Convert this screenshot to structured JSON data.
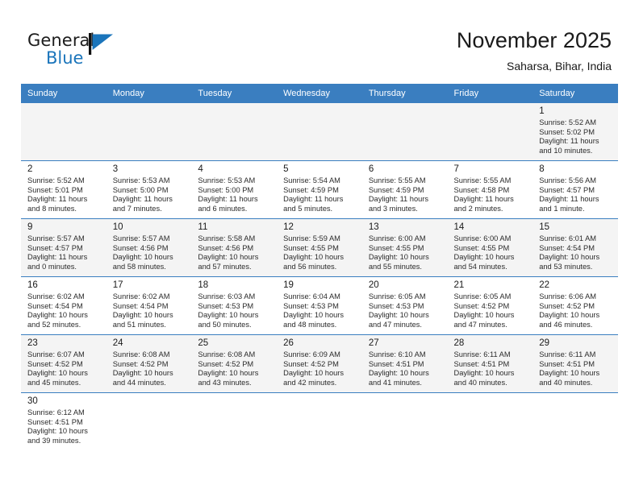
{
  "brand": {
    "name_part1": "General",
    "name_part2": "Blue",
    "flag_icon": "blue-triangle-flag-icon",
    "accent_color": "#1b75bb"
  },
  "header": {
    "title": "November 2025",
    "subtitle": "Saharsa, Bihar, India"
  },
  "calendar": {
    "header_bg": "#3a7ec0",
    "alt_row_bg": "#f4f4f4",
    "weekday_headers": [
      "Sunday",
      "Monday",
      "Tuesday",
      "Wednesday",
      "Thursday",
      "Friday",
      "Saturday"
    ],
    "weeks": [
      [
        {
          "day": "",
          "sunrise": "",
          "sunset": "",
          "daylight_line1": "",
          "daylight_line2": ""
        },
        {
          "day": "",
          "sunrise": "",
          "sunset": "",
          "daylight_line1": "",
          "daylight_line2": ""
        },
        {
          "day": "",
          "sunrise": "",
          "sunset": "",
          "daylight_line1": "",
          "daylight_line2": ""
        },
        {
          "day": "",
          "sunrise": "",
          "sunset": "",
          "daylight_line1": "",
          "daylight_line2": ""
        },
        {
          "day": "",
          "sunrise": "",
          "sunset": "",
          "daylight_line1": "",
          "daylight_line2": ""
        },
        {
          "day": "",
          "sunrise": "",
          "sunset": "",
          "daylight_line1": "",
          "daylight_line2": ""
        },
        {
          "day": "1",
          "sunrise": "Sunrise: 5:52 AM",
          "sunset": "Sunset: 5:02 PM",
          "daylight_line1": "Daylight: 11 hours",
          "daylight_line2": "and 10 minutes."
        }
      ],
      [
        {
          "day": "2",
          "sunrise": "Sunrise: 5:52 AM",
          "sunset": "Sunset: 5:01 PM",
          "daylight_line1": "Daylight: 11 hours",
          "daylight_line2": "and 8 minutes."
        },
        {
          "day": "3",
          "sunrise": "Sunrise: 5:53 AM",
          "sunset": "Sunset: 5:00 PM",
          "daylight_line1": "Daylight: 11 hours",
          "daylight_line2": "and 7 minutes."
        },
        {
          "day": "4",
          "sunrise": "Sunrise: 5:53 AM",
          "sunset": "Sunset: 5:00 PM",
          "daylight_line1": "Daylight: 11 hours",
          "daylight_line2": "and 6 minutes."
        },
        {
          "day": "5",
          "sunrise": "Sunrise: 5:54 AM",
          "sunset": "Sunset: 4:59 PM",
          "daylight_line1": "Daylight: 11 hours",
          "daylight_line2": "and 5 minutes."
        },
        {
          "day": "6",
          "sunrise": "Sunrise: 5:55 AM",
          "sunset": "Sunset: 4:59 PM",
          "daylight_line1": "Daylight: 11 hours",
          "daylight_line2": "and 3 minutes."
        },
        {
          "day": "7",
          "sunrise": "Sunrise: 5:55 AM",
          "sunset": "Sunset: 4:58 PM",
          "daylight_line1": "Daylight: 11 hours",
          "daylight_line2": "and 2 minutes."
        },
        {
          "day": "8",
          "sunrise": "Sunrise: 5:56 AM",
          "sunset": "Sunset: 4:57 PM",
          "daylight_line1": "Daylight: 11 hours",
          "daylight_line2": "and 1 minute."
        }
      ],
      [
        {
          "day": "9",
          "sunrise": "Sunrise: 5:57 AM",
          "sunset": "Sunset: 4:57 PM",
          "daylight_line1": "Daylight: 11 hours",
          "daylight_line2": "and 0 minutes."
        },
        {
          "day": "10",
          "sunrise": "Sunrise: 5:57 AM",
          "sunset": "Sunset: 4:56 PM",
          "daylight_line1": "Daylight: 10 hours",
          "daylight_line2": "and 58 minutes."
        },
        {
          "day": "11",
          "sunrise": "Sunrise: 5:58 AM",
          "sunset": "Sunset: 4:56 PM",
          "daylight_line1": "Daylight: 10 hours",
          "daylight_line2": "and 57 minutes."
        },
        {
          "day": "12",
          "sunrise": "Sunrise: 5:59 AM",
          "sunset": "Sunset: 4:55 PM",
          "daylight_line1": "Daylight: 10 hours",
          "daylight_line2": "and 56 minutes."
        },
        {
          "day": "13",
          "sunrise": "Sunrise: 6:00 AM",
          "sunset": "Sunset: 4:55 PM",
          "daylight_line1": "Daylight: 10 hours",
          "daylight_line2": "and 55 minutes."
        },
        {
          "day": "14",
          "sunrise": "Sunrise: 6:00 AM",
          "sunset": "Sunset: 4:55 PM",
          "daylight_line1": "Daylight: 10 hours",
          "daylight_line2": "and 54 minutes."
        },
        {
          "day": "15",
          "sunrise": "Sunrise: 6:01 AM",
          "sunset": "Sunset: 4:54 PM",
          "daylight_line1": "Daylight: 10 hours",
          "daylight_line2": "and 53 minutes."
        }
      ],
      [
        {
          "day": "16",
          "sunrise": "Sunrise: 6:02 AM",
          "sunset": "Sunset: 4:54 PM",
          "daylight_line1": "Daylight: 10 hours",
          "daylight_line2": "and 52 minutes."
        },
        {
          "day": "17",
          "sunrise": "Sunrise: 6:02 AM",
          "sunset": "Sunset: 4:54 PM",
          "daylight_line1": "Daylight: 10 hours",
          "daylight_line2": "and 51 minutes."
        },
        {
          "day": "18",
          "sunrise": "Sunrise: 6:03 AM",
          "sunset": "Sunset: 4:53 PM",
          "daylight_line1": "Daylight: 10 hours",
          "daylight_line2": "and 50 minutes."
        },
        {
          "day": "19",
          "sunrise": "Sunrise: 6:04 AM",
          "sunset": "Sunset: 4:53 PM",
          "daylight_line1": "Daylight: 10 hours",
          "daylight_line2": "and 48 minutes."
        },
        {
          "day": "20",
          "sunrise": "Sunrise: 6:05 AM",
          "sunset": "Sunset: 4:53 PM",
          "daylight_line1": "Daylight: 10 hours",
          "daylight_line2": "and 47 minutes."
        },
        {
          "day": "21",
          "sunrise": "Sunrise: 6:05 AM",
          "sunset": "Sunset: 4:52 PM",
          "daylight_line1": "Daylight: 10 hours",
          "daylight_line2": "and 47 minutes."
        },
        {
          "day": "22",
          "sunrise": "Sunrise: 6:06 AM",
          "sunset": "Sunset: 4:52 PM",
          "daylight_line1": "Daylight: 10 hours",
          "daylight_line2": "and 46 minutes."
        }
      ],
      [
        {
          "day": "23",
          "sunrise": "Sunrise: 6:07 AM",
          "sunset": "Sunset: 4:52 PM",
          "daylight_line1": "Daylight: 10 hours",
          "daylight_line2": "and 45 minutes."
        },
        {
          "day": "24",
          "sunrise": "Sunrise: 6:08 AM",
          "sunset": "Sunset: 4:52 PM",
          "daylight_line1": "Daylight: 10 hours",
          "daylight_line2": "and 44 minutes."
        },
        {
          "day": "25",
          "sunrise": "Sunrise: 6:08 AM",
          "sunset": "Sunset: 4:52 PM",
          "daylight_line1": "Daylight: 10 hours",
          "daylight_line2": "and 43 minutes."
        },
        {
          "day": "26",
          "sunrise": "Sunrise: 6:09 AM",
          "sunset": "Sunset: 4:52 PM",
          "daylight_line1": "Daylight: 10 hours",
          "daylight_line2": "and 42 minutes."
        },
        {
          "day": "27",
          "sunrise": "Sunrise: 6:10 AM",
          "sunset": "Sunset: 4:51 PM",
          "daylight_line1": "Daylight: 10 hours",
          "daylight_line2": "and 41 minutes."
        },
        {
          "day": "28",
          "sunrise": "Sunrise: 6:11 AM",
          "sunset": "Sunset: 4:51 PM",
          "daylight_line1": "Daylight: 10 hours",
          "daylight_line2": "and 40 minutes."
        },
        {
          "day": "29",
          "sunrise": "Sunrise: 6:11 AM",
          "sunset": "Sunset: 4:51 PM",
          "daylight_line1": "Daylight: 10 hours",
          "daylight_line2": "and 40 minutes."
        }
      ],
      [
        {
          "day": "30",
          "sunrise": "Sunrise: 6:12 AM",
          "sunset": "Sunset: 4:51 PM",
          "daylight_line1": "Daylight: 10 hours",
          "daylight_line2": "and 39 minutes."
        },
        {
          "day": "",
          "sunrise": "",
          "sunset": "",
          "daylight_line1": "",
          "daylight_line2": ""
        },
        {
          "day": "",
          "sunrise": "",
          "sunset": "",
          "daylight_line1": "",
          "daylight_line2": ""
        },
        {
          "day": "",
          "sunrise": "",
          "sunset": "",
          "daylight_line1": "",
          "daylight_line2": ""
        },
        {
          "day": "",
          "sunrise": "",
          "sunset": "",
          "daylight_line1": "",
          "daylight_line2": ""
        },
        {
          "day": "",
          "sunrise": "",
          "sunset": "",
          "daylight_line1": "",
          "daylight_line2": ""
        },
        {
          "day": "",
          "sunrise": "",
          "sunset": "",
          "daylight_line1": "",
          "daylight_line2": ""
        }
      ]
    ]
  }
}
